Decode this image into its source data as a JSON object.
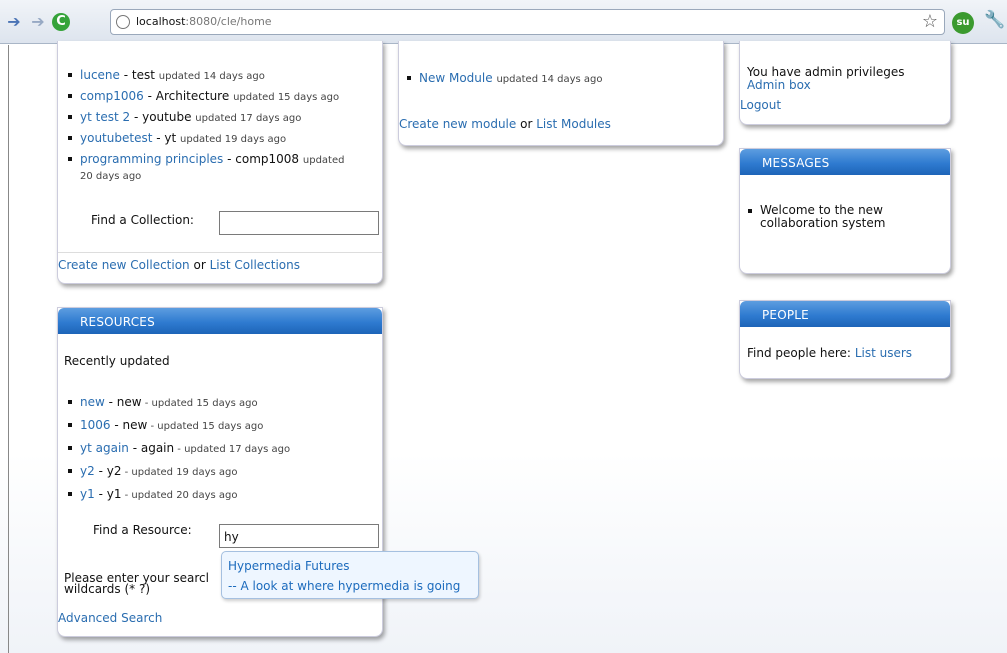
{
  "browser": {
    "url_host": "localhost",
    "url_path": ":8080/cle/home"
  },
  "collections": {
    "items": [
      {
        "title": "lucene",
        "sep": " - ",
        "owner": "test",
        "updated": "updated 14 days ago"
      },
      {
        "title": "comp1006",
        "sep": " - ",
        "owner": "Architecture",
        "updated": "updated 15 days ago"
      },
      {
        "title": "yt test 2",
        "sep": " - ",
        "owner": "youtube",
        "updated": "updated 17 days ago"
      },
      {
        "title": "youtubetest",
        "sep": " - ",
        "owner": "yt",
        "updated": "updated 19 days ago"
      },
      {
        "title": "programming principles",
        "sep": " - ",
        "owner": "comp1008",
        "updated": "updated",
        "updated2": "20 days ago"
      }
    ],
    "find_label": "Find a Collection:",
    "find_value": "",
    "create_link": "Create new Collection",
    "or": "or",
    "list_link": "List Collections"
  },
  "modules": {
    "items": [
      {
        "title": "New Module",
        "updated": "updated 14 days ago"
      }
    ],
    "create_link": "Create new module",
    "or": "or",
    "list_link": "List Modules"
  },
  "admin": {
    "privileges_text": "You have admin privileges",
    "admin_box_link": "Admin box",
    "logout_link": "Logout"
  },
  "messages": {
    "header": "MESSAGES",
    "items": [
      "Welcome to the new",
      "collaboration system"
    ]
  },
  "people": {
    "header": "PEOPLE",
    "find_text": "Find people here:",
    "list_link": "List users"
  },
  "resources": {
    "header": "RESOURCES",
    "recently": "Recently updated",
    "items": [
      {
        "title": "new",
        "sep": " - ",
        "owner": "new",
        "updated": " - updated 15 days ago"
      },
      {
        "title": "1006",
        "sep": " - ",
        "owner": "new",
        "updated": " - updated 15 days ago"
      },
      {
        "title": "yt again",
        "sep": " - ",
        "owner": "again",
        "updated": " - updated 17 days ago"
      },
      {
        "title": "y2",
        "sep": " - ",
        "owner": "y2",
        "updated": " - updated 19 days ago"
      },
      {
        "title": "y1",
        "sep": " - ",
        "owner": "y1",
        "updated": " - updated 20 days ago"
      }
    ],
    "find_label": "Find a Resource:",
    "find_value": "hy",
    "hint_line1": "Please enter your searcl",
    "hint_line2": "wildcards (* ?)",
    "advanced_link": "Advanced Search",
    "suggestion_title": "Hypermedia Futures",
    "suggestion_desc": "-- A look at where hypermedia is going"
  },
  "colors": {
    "link": "#2a6db0",
    "header_blue": "#2f7bd0"
  }
}
